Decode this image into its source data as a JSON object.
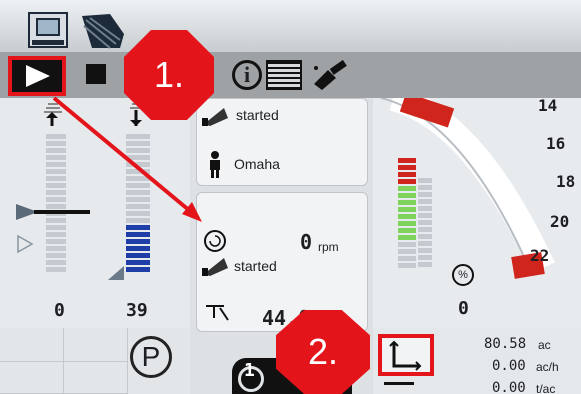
{
  "toolbar": {
    "icons": [
      "terminal-icon",
      "field-icon",
      "play-icon",
      "stop-icon",
      "info-icon",
      "list-icon",
      "satellite-icon"
    ]
  },
  "annotations": {
    "callout_1": "1.",
    "callout_2": "2."
  },
  "left_gauges": {
    "left_value": "0",
    "right_value": "39"
  },
  "middle": {
    "top_status": "started",
    "location": "Omaha",
    "rpm_value": "0",
    "rpm_unit": "rpm",
    "second_status": "started",
    "partial_value": "44.0",
    "bottom_badge": "1"
  },
  "right_gauge": {
    "ticks": [
      "14",
      "16",
      "18",
      "20",
      "22"
    ],
    "percent_symbol": "%",
    "value": "0"
  },
  "bottom_right": {
    "area": "80.58",
    "area_unit": "ac",
    "rate": "0.00",
    "rate_unit": "ac/h",
    "third": "0.00",
    "third_unit": "t/ac"
  },
  "bottom_left": {
    "parking_symbol": "P"
  },
  "colors": {
    "accent_red": "#e4141b",
    "bar_blue": "#1f3fa8",
    "bar_green": "#7fd35a",
    "bar_red": "#d0251c"
  }
}
